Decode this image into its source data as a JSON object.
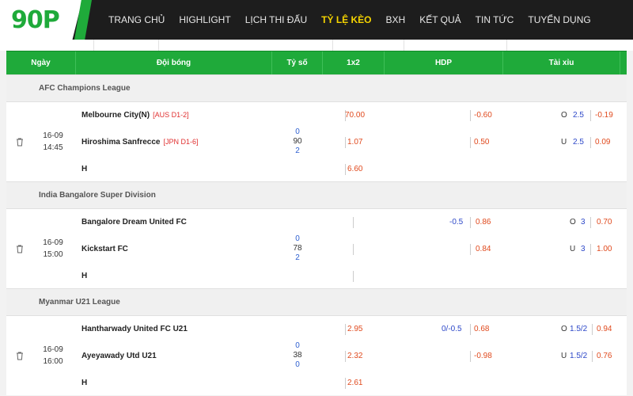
{
  "logo": "90P",
  "nav": [
    "TRANG CHỦ",
    "HIGHLIGHT",
    "LỊCH THI ĐẤU",
    "TỶ LỆ KÈO",
    "BXH",
    "KẾT QUẢ",
    "TIN TỨC",
    "TUYỂN DỤNG"
  ],
  "nav_active": "TỶ LỆ KÈO",
  "headers": {
    "date": "Ngày",
    "teams": "Đội bóng",
    "score": "Tỷ số",
    "onextwo": "1x2",
    "hdp": "HDP",
    "ou": "Tài xỉu"
  },
  "colors": {
    "green": "#1faa3a",
    "nav_bg": "#1d1d1d",
    "active": "#f5d400",
    "red": "#e04a1e",
    "blue": "#2d48c8"
  },
  "leagues": [
    {
      "name": "AFC Champions League",
      "date": "16-09",
      "time": "14:45",
      "home": "Melbourne City(N)",
      "home_rank": "[AUS D1-2]",
      "away": "Hiroshima Sanfrecce",
      "away_rank": "[JPN D1-6]",
      "draw": "H",
      "score_top": "0",
      "score_mid": "90",
      "score_bot": "2",
      "x12": [
        "70.00",
        "1.07",
        "6.60"
      ],
      "hdp_line": [
        "",
        ""
      ],
      "hdp_odds": [
        "-0.60",
        "0.50"
      ],
      "ou_label": [
        "O",
        "U"
      ],
      "ou_line": [
        "2.5",
        "2.5"
      ],
      "ou_odds": [
        "-0.19",
        "0.09"
      ]
    },
    {
      "name": "India Bangalore Super Division",
      "date": "16-09",
      "time": "15:00",
      "home": "Bangalore Dream United FC",
      "home_rank": "",
      "away": "Kickstart FC",
      "away_rank": "",
      "draw": "H",
      "score_top": "0",
      "score_mid": "78",
      "score_bot": "2",
      "x12": [
        "",
        "",
        ""
      ],
      "hdp_line": [
        "-0.5",
        ""
      ],
      "hdp_odds": [
        "0.86",
        "0.84"
      ],
      "ou_label": [
        "O",
        "U"
      ],
      "ou_line": [
        "3",
        "3"
      ],
      "ou_odds": [
        "0.70",
        "1.00"
      ]
    },
    {
      "name": "Myanmar U21 League",
      "date": "16-09",
      "time": "16:00",
      "home": "Hantharwady United FC U21",
      "home_rank": "",
      "away": "Ayeyawady Utd U21",
      "away_rank": "",
      "draw": "H",
      "score_top": "0",
      "score_mid": "38",
      "score_bot": "0",
      "x12": [
        "2.95",
        "2.32",
        "2.61"
      ],
      "hdp_line": [
        "0/-0.5",
        ""
      ],
      "hdp_odds": [
        "0.68",
        "-0.98"
      ],
      "ou_label": [
        "O",
        "U"
      ],
      "ou_line": [
        "1.5/2",
        "1.5/2"
      ],
      "ou_odds": [
        "0.94",
        "0.76"
      ]
    }
  ]
}
